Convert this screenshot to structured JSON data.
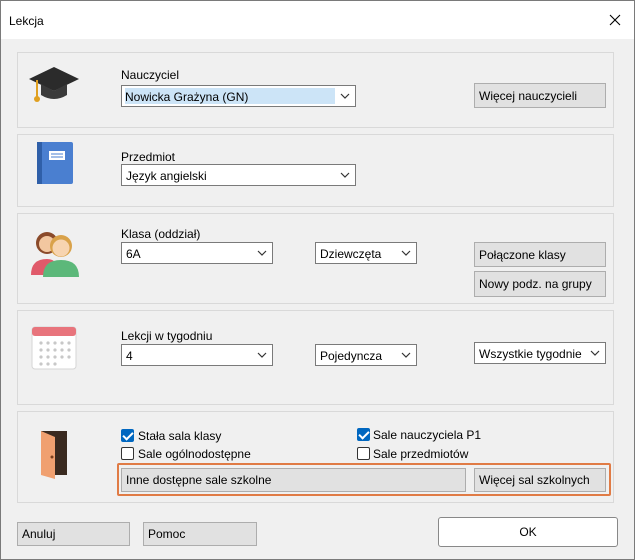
{
  "window": {
    "title": "Lekcja"
  },
  "teacher": {
    "label": "Nauczyciel",
    "value": "Nowicka Grażyna (GN)",
    "more_button": "Więcej nauczycieli"
  },
  "subject": {
    "label": "Przedmiot",
    "value": "Język angielski"
  },
  "class": {
    "label": "Klasa (oddział)",
    "value": "6A",
    "group_value": "Dziewczęta",
    "joined_button": "Połączone klasy",
    "new_split_button": "Nowy podz. na grupy"
  },
  "lessons": {
    "label": "Lekcji w tygodniu",
    "count_value": "4",
    "type_value": "Pojedyncza",
    "weeks_value": "Wszystkie tygodnie"
  },
  "rooms": {
    "fixed_class_room": {
      "label": "Stała sala klasy",
      "checked": true
    },
    "teacher_room": {
      "label": "Sale nauczyciela P1",
      "checked": true
    },
    "shared_rooms": {
      "label": "Sale ogólnodostępne",
      "checked": false
    },
    "subject_rooms": {
      "label": "Sale przedmiotów",
      "checked": false
    },
    "other_rooms_button": "Inne dostępne sale szkolne",
    "more_rooms_button": "Więcej sal szkolnych"
  },
  "footer": {
    "cancel": "Anuluj",
    "help": "Pomoc",
    "ok": "OK"
  },
  "colors": {
    "accent": "#0067c0",
    "highlight_border": "#e07b45"
  }
}
